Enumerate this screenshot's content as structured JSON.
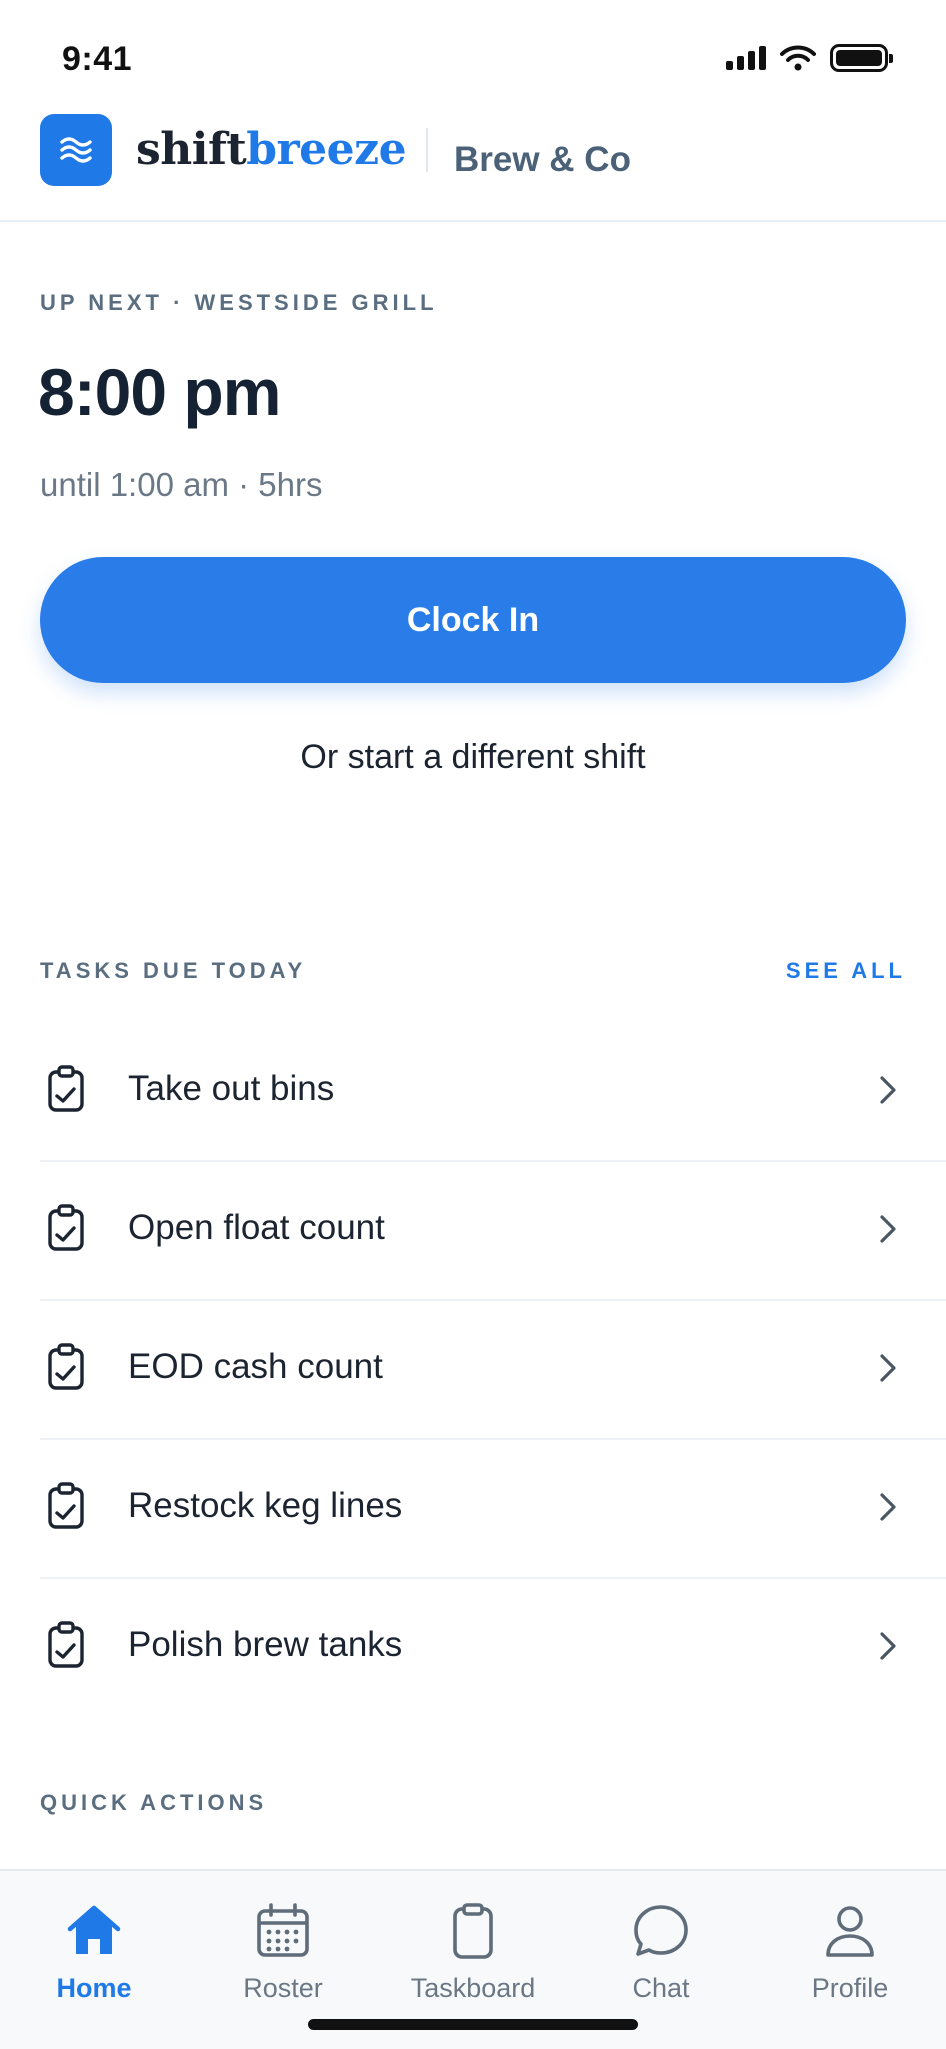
{
  "status_bar": {
    "time": "9:41",
    "icons": [
      "cellular-signal-icon",
      "wifi-icon",
      "battery-icon"
    ]
  },
  "header": {
    "logo_icon": "waves-icon",
    "brand_part_a": "shift",
    "brand_part_b": "breeze",
    "org_name": "Brew & Co"
  },
  "next_shift": {
    "label": "UP NEXT · WESTSIDE GRILL",
    "start_time": "8:00 pm",
    "range": "until 1:00 am · 5hrs",
    "clock_in_label": "Clock In",
    "alt_link": "Or start a different shift"
  },
  "tasks": {
    "label": "TASKS DUE TODAY",
    "see_all": "SEE ALL",
    "items": [
      {
        "title": "Take out bins",
        "icon": "clipboard-check-icon"
      },
      {
        "title": "Open float count",
        "icon": "clipboard-check-icon"
      },
      {
        "title": "EOD cash count",
        "icon": "clipboard-check-icon"
      },
      {
        "title": "Restock keg lines",
        "icon": "clipboard-check-icon"
      },
      {
        "title": "Polish brew tanks",
        "icon": "clipboard-check-icon"
      }
    ]
  },
  "quick_actions": {
    "label": "QUICK ACTIONS"
  },
  "tab_bar": {
    "tabs": [
      {
        "label": "Home",
        "icon": "home-icon",
        "active": true
      },
      {
        "label": "Roster",
        "icon": "calendar-icon",
        "active": false
      },
      {
        "label": "Taskboard",
        "icon": "clipboard-icon",
        "active": false
      },
      {
        "label": "Chat",
        "icon": "chat-bubble-icon",
        "active": false
      },
      {
        "label": "Profile",
        "icon": "user-icon",
        "active": false
      }
    ]
  },
  "colors": {
    "accent": "#1f7ae8",
    "button": "#2a7de9",
    "text_primary": "#1b2430",
    "text_muted": "#6a7887"
  }
}
